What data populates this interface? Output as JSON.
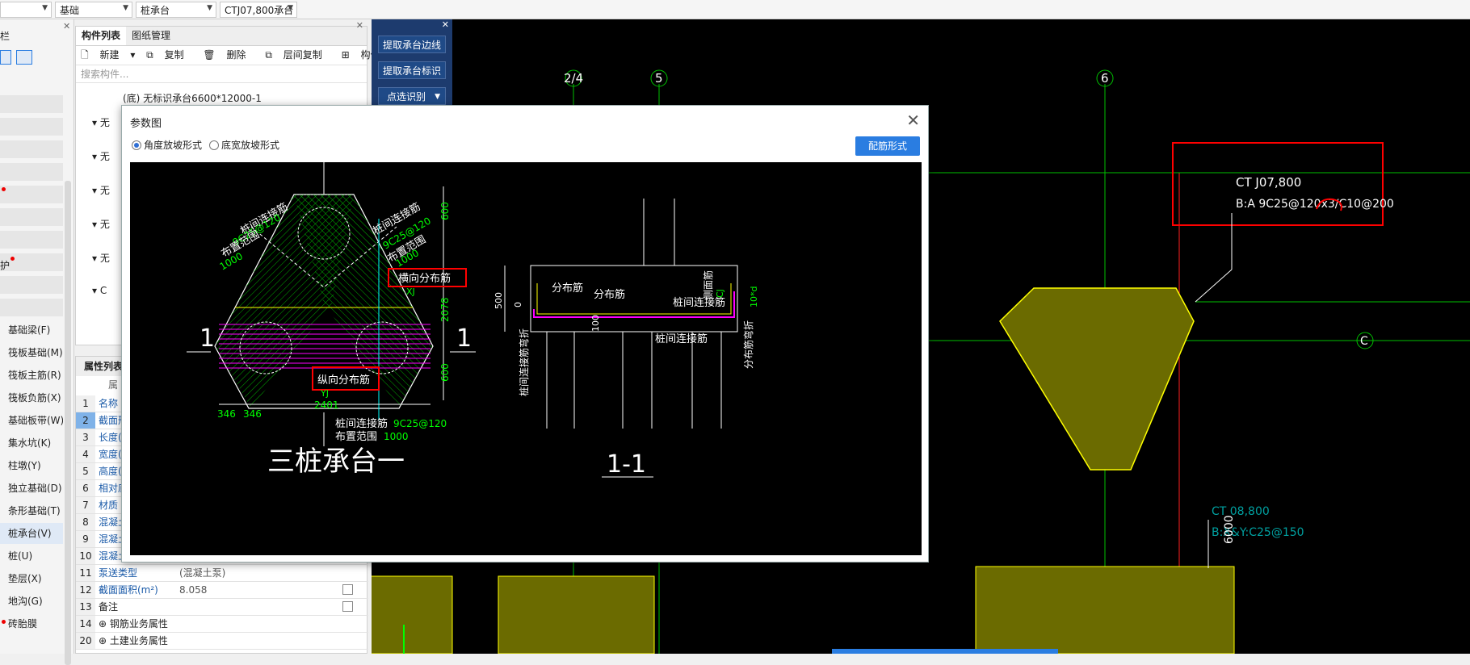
{
  "topbar": {
    "dd1": "",
    "dd2": "基础",
    "dd3": "桩承台",
    "dd4": "CTJ07,800承台"
  },
  "leftnav": {
    "title_stub": "栏",
    "items": [
      {
        "label": "基础梁(F)"
      },
      {
        "label": "筏板基础(M)"
      },
      {
        "label": "筏板主筋(R)"
      },
      {
        "label": "筏板负筋(X)"
      },
      {
        "label": "基础板带(W)"
      },
      {
        "label": "集水坑(K)"
      },
      {
        "label": "柱墩(Y)"
      },
      {
        "label": "独立基础(D)"
      },
      {
        "label": "条形基础(T)"
      },
      {
        "label": "桩承台(V)"
      },
      {
        "label": "桩(U)"
      },
      {
        "label": "垫层(X)"
      },
      {
        "label": "地沟(G)"
      },
      {
        "label": "砖胎膜"
      }
    ],
    "stub_texts": [
      "护"
    ]
  },
  "component_panel": {
    "tabs": [
      "构件列表",
      "图纸管理"
    ],
    "toolbar": [
      "新建",
      "复制",
      "删除",
      "层间复制",
      "构件存盘"
    ],
    "search_placeholder": "搜索构件...",
    "tree_top": "(底) 无标识承台6600*12000-1",
    "tree_stubs": [
      "无",
      "无",
      "无",
      "无",
      "无",
      "C"
    ]
  },
  "props": {
    "header": "属性列表",
    "col_stub": "属",
    "rows": [
      {
        "n": "1",
        "k": "名称",
        "v": ""
      },
      {
        "n": "2",
        "k": "截面形",
        "v": ""
      },
      {
        "n": "3",
        "k": "长度(",
        "v": ""
      },
      {
        "n": "4",
        "k": "宽度(",
        "v": ""
      },
      {
        "n": "5",
        "k": "高度(",
        "v": ""
      },
      {
        "n": "6",
        "k": "相对底",
        "v": ""
      },
      {
        "n": "7",
        "k": "材质",
        "v": ""
      },
      {
        "n": "8",
        "k": "混凝土",
        "v": ""
      },
      {
        "n": "9",
        "k": "混凝土",
        "v": ""
      },
      {
        "n": "10",
        "k": "混凝土",
        "v": ""
      },
      {
        "n": "11",
        "k": "泵送类型",
        "v": "(混凝土泵)"
      },
      {
        "n": "12",
        "k": "截面面积(m²)",
        "v": "8.058"
      },
      {
        "n": "13",
        "k": "备注",
        "v": ""
      },
      {
        "n": "14",
        "k": "钢筋业务属性",
        "v": ""
      },
      {
        "n": "20",
        "k": "土建业务属性",
        "v": ""
      }
    ]
  },
  "cad_buttons": [
    "提取承台边线",
    "提取承台标识",
    "点选识别"
  ],
  "cad": {
    "axes": [
      "2/4",
      "5",
      "6",
      "C"
    ],
    "label1_l1": "CT J07,800",
    "label1_l2": "B:A 9C25@120x3/C10@200",
    "label2_l1": "CT 08,800",
    "label2_l2": "B:X&Y:C25@150",
    "dim_6000": "6000"
  },
  "dialog": {
    "title": "参数图",
    "radio1": "角度放坡形式",
    "radio2": "底宽放坡形式",
    "button": "配筋形式",
    "drawing": {
      "lbl_pile_conn1": "桩间连接筋",
      "lbl_9c25_1": "9C25@120",
      "lbl_range1": "布置范围",
      "lbl_1000a": "1000",
      "lbl_pile_conn2": "桩间连接筋",
      "lbl_9c25_2": "9C25@120",
      "lbl_range2": "布置范围",
      "lbl_1000b": "1000",
      "lbl_transverse": "横向分布筋",
      "lbl_xj": "XJ",
      "lbl_longitudinal": "纵向分布筋",
      "lbl_yj": "YJ",
      "dim_600a": "600",
      "dim_2078": "2078",
      "dim_600b": "600",
      "dim_2401": "2401",
      "dim_346a": "346",
      "dim_346b": "346",
      "lbl_bottom_conn": "桩间连接筋",
      "lbl_bottom_9c25": "9C25@120",
      "lbl_bottom_range": "布置范围",
      "lbl_bottom_1000": "1000",
      "sec_mark_left": "1",
      "sec_mark_right": "1",
      "title_left": "三桩承台一",
      "title_right": "1-1",
      "s_dist1": "分布筋",
      "s_dist2": "分布筋",
      "s_side": "侧面筋",
      "s_cj": "CJ",
      "s_conn": "桩间连接筋",
      "s_conn2": "桩间连接筋",
      "s_10d": "10*d",
      "s_500": "500",
      "s_0": "0",
      "s_100": "100",
      "s_bend_left": "桩间连接筋弯折",
      "s_bend_right": "分布筋弯折"
    }
  },
  "colors": {
    "cad_bg": "#000000",
    "accent": "#2a7de1",
    "cad_green": "#00ff00",
    "cad_yellow": "#ffff00",
    "cad_magenta": "#ff00ff",
    "cad_red": "#ff0000",
    "olive": "#6b6b00"
  }
}
